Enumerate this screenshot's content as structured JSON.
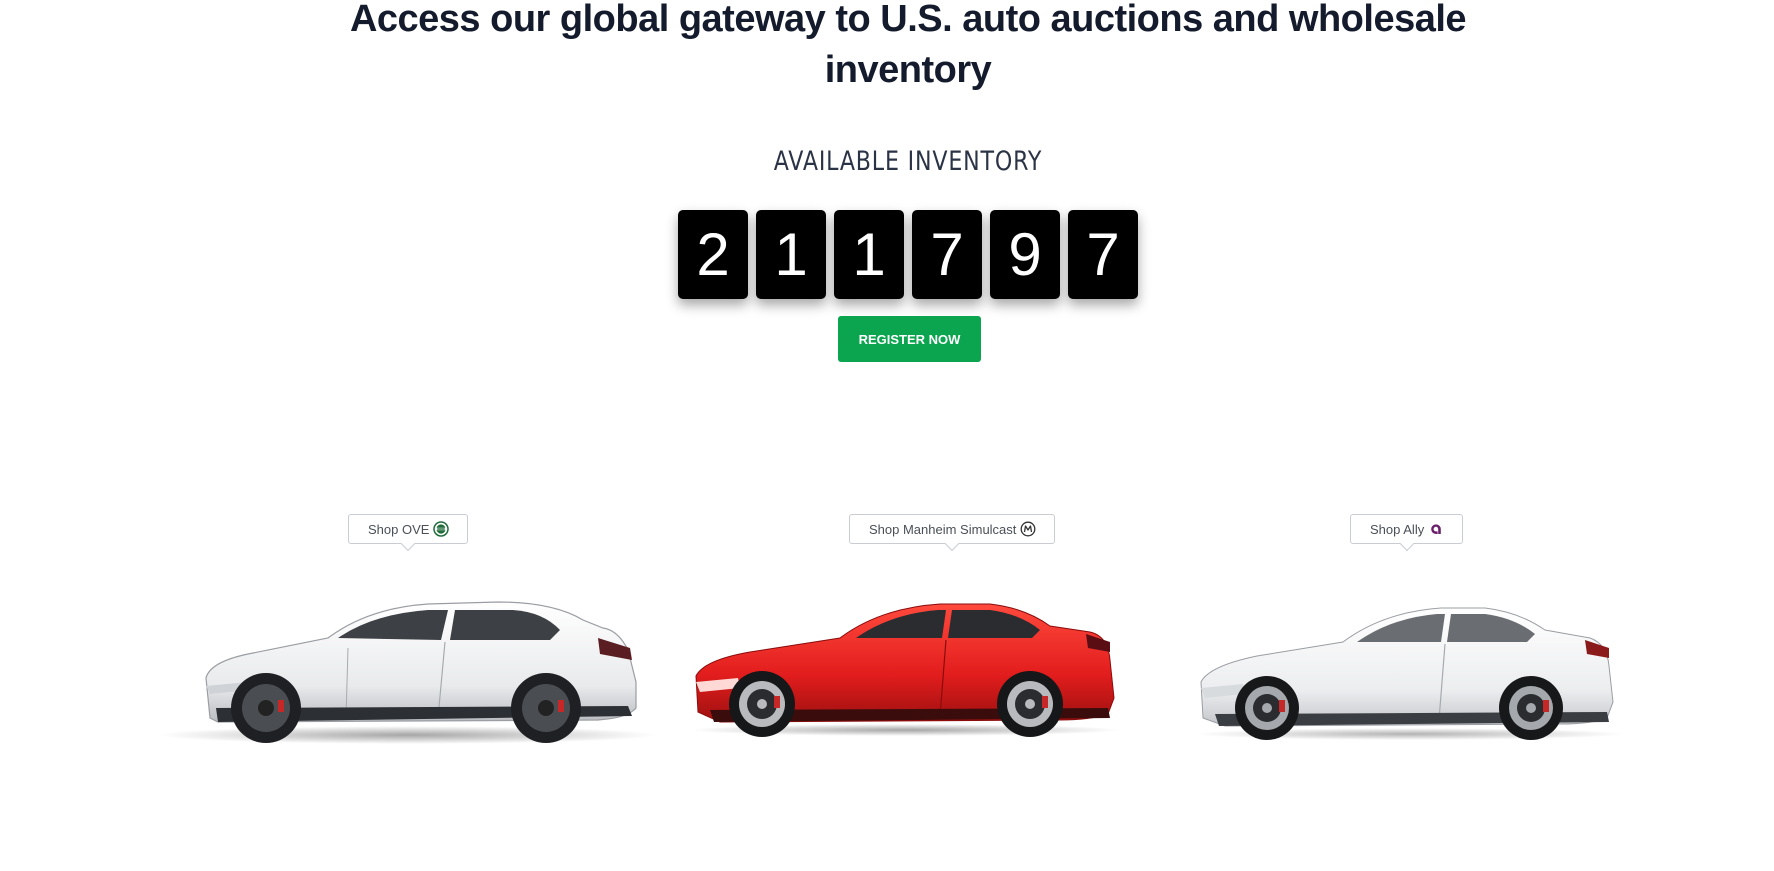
{
  "hero": {
    "headline_line1": "Access our global gateway to U.S. auto auctions and wholesale",
    "headline_line2": "inventory",
    "inventory_label": "AVAILABLE INVENTORY",
    "inventory_digits": [
      "2",
      "1",
      "1",
      "7",
      "9",
      "7"
    ],
    "register_label": "REGISTER NOW"
  },
  "shops": [
    {
      "label": "Shop OVE",
      "icon": "ove-logo-icon",
      "car": "white-suv-car",
      "icon_color": "#1f6b3a"
    },
    {
      "label": "Shop Manheim Simulcast",
      "icon": "manheim-logo-icon",
      "car": "red-coupe-car",
      "icon_color": "#333333"
    },
    {
      "label": "Shop Ally",
      "icon": "ally-logo-icon",
      "car": "white-coupe-car",
      "icon_color": "#6b1f6b"
    }
  ],
  "colors": {
    "headline": "#141b2d",
    "register_button": "#0ba54f",
    "digit_bg": "#000000",
    "red_car": "#e21d1d"
  }
}
